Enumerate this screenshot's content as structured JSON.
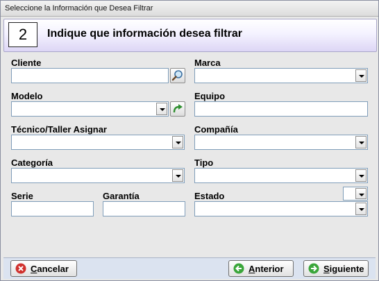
{
  "window": {
    "title": "Seleccione la Información que Desea Filtrar"
  },
  "header": {
    "step": "2",
    "text": "Indique que información desea filtrar"
  },
  "form": {
    "cliente": {
      "label": "Cliente",
      "value": ""
    },
    "marca": {
      "label": "Marca",
      "value": ""
    },
    "modelo": {
      "label": "Modelo",
      "value": ""
    },
    "equipo": {
      "label": "Equipo",
      "value": ""
    },
    "tecnico": {
      "label": "Técnico/Taller Asignar",
      "value": ""
    },
    "compania": {
      "label": "Compañía",
      "value": ""
    },
    "categoria": {
      "label": "Categoría",
      "value": ""
    },
    "tipo": {
      "label": "Tipo",
      "value": ""
    },
    "serie": {
      "label": "Serie",
      "value": ""
    },
    "garantia": {
      "label": "Garantía",
      "value": ""
    },
    "estado": {
      "label": "Estado",
      "value": ""
    }
  },
  "buttons": {
    "cancel": "Cancelar",
    "back": "Anterior",
    "next": "Siguiente"
  },
  "colors": {
    "cancel_icon": "#d0312d",
    "nav_icon": "#3aa63a",
    "header_gradient_end": "#ddd6f5"
  },
  "icons": {
    "search": "magnifier-icon",
    "refresh": "green-arrow-icon"
  }
}
